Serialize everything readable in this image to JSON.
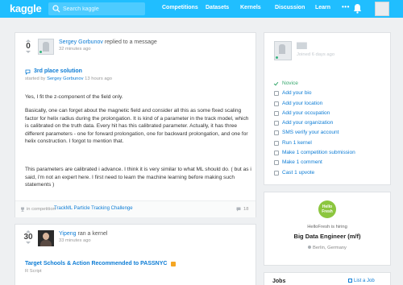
{
  "nav": {
    "logo": "kaggle",
    "search_placeholder": "Search kaggle",
    "items": [
      "Competitions",
      "Datasets",
      "Kernels",
      "Discussion",
      "Learn"
    ],
    "more": "•••"
  },
  "post1": {
    "votes": "0",
    "author": "Sergey Gorbunov",
    "action": "replied to a message",
    "time": "32 minutes ago",
    "thread_title": "3rd place solution",
    "started_by_prefix": "started by",
    "started_by": "Sergey Gorbunov",
    "started_time": "13 hours ago",
    "paragraphs": [
      "Yes, I fit the z-component of the field only.",
      "Basically, one can forget about the magnetic field and consider all this as some fixed scaling factor for helix radius during the prolongation. It is kind of a parameter in the track model, which is calibrated on the truth data. Every hit has this calibrated parameter. Actually, it has three different parameters - one for forward prolongation, one for backward prolongation, and one for helix construction. I forgot to mention that.",
      "This parameters are calibrated i advance. I think it is very similar to what ML should do. ( but as i said, i'm not an expert here. I first need to learn the machine learning before making such statements )"
    ],
    "competition_prefix": "in competition",
    "competition": "TrackML Particle Tracking Challenge",
    "comments": "18"
  },
  "post2": {
    "votes": "30",
    "author": "Yipeng",
    "action": "ran a kernel",
    "time": "33 minutes ago",
    "kernel_title": "Target Schools & Action Recommended to PASSNYC",
    "language": "R Script"
  },
  "profile": {
    "name": "███",
    "joined": "Joined 6 days ago",
    "checklist": [
      {
        "label": "Novice",
        "done": true
      },
      {
        "label": "Add your bio",
        "done": false
      },
      {
        "label": "Add your location",
        "done": false
      },
      {
        "label": "Add your occupation",
        "done": false
      },
      {
        "label": "Add your organization",
        "done": false
      },
      {
        "label": "SMS verify your account",
        "done": false
      },
      {
        "label": "Run 1 kernel",
        "done": false
      },
      {
        "label": "Make 1 competition submission",
        "done": false
      },
      {
        "label": "Make 1 comment",
        "done": false
      },
      {
        "label": "Cast 1 upvote",
        "done": false
      }
    ]
  },
  "job": {
    "logo_text": "Hello Fresh",
    "hiring": "HelloFresh is hiring",
    "title": "Big Data Engineer (m/f)",
    "location": "Berlin, Germany"
  },
  "jobs": {
    "heading": "Jobs",
    "list_link": "List a Job"
  },
  "colors": {
    "brand": "#20beff",
    "link": "#0c7cd5",
    "success": "#36a86c"
  }
}
